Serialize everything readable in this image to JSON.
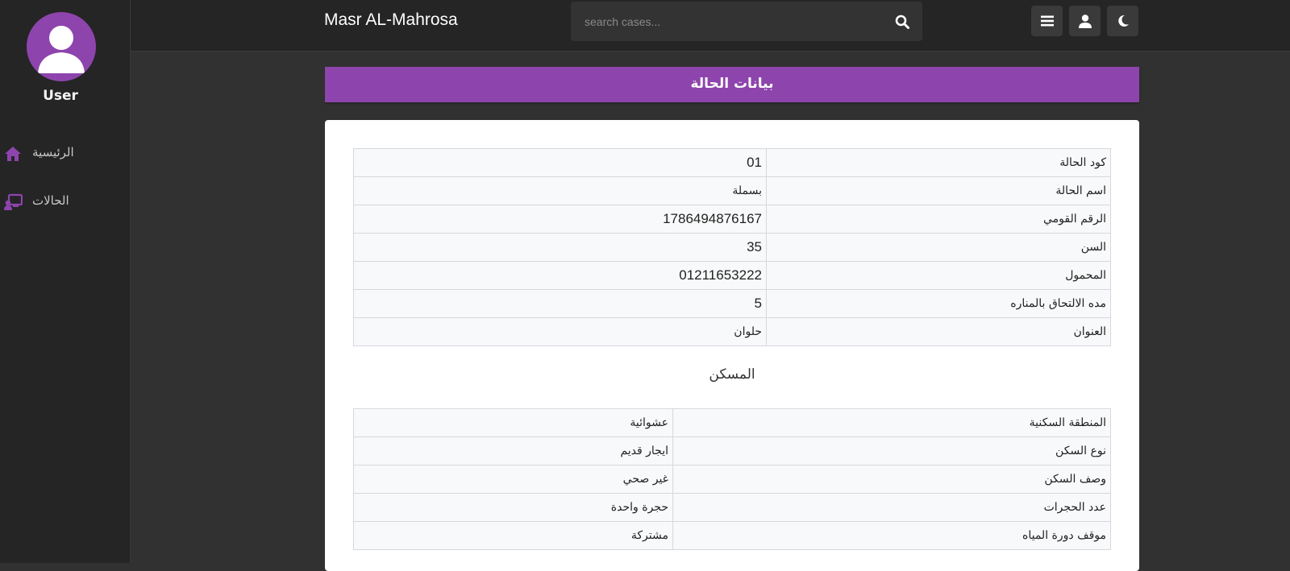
{
  "sidebar": {
    "user_name": "User",
    "items": [
      {
        "label": "الرئيسية",
        "icon": "home-icon"
      },
      {
        "label": "الحالات",
        "icon": "cases-icon"
      }
    ]
  },
  "topbar": {
    "brand": "Masr AL-Mahrosa",
    "search_placeholder": "search cases...",
    "buttons": [
      "menu-icon",
      "user-icon",
      "moon-icon"
    ]
  },
  "page": {
    "header": "بيانات الحالة",
    "case_info": [
      {
        "key": "كود الحالة",
        "value": "01"
      },
      {
        "key": "اسم الحالة",
        "value": "بسملة"
      },
      {
        "key": "الرقم القومي",
        "value": "1786494876167"
      },
      {
        "key": "السن",
        "value": "35"
      },
      {
        "key": "المحمول",
        "value": "01211653222"
      },
      {
        "key": "مده الالتحاق بالمناره",
        "value": "5"
      },
      {
        "key": "العنوان",
        "value": "حلوان"
      }
    ],
    "housing_title": "المسكن",
    "housing": [
      {
        "key": "المنطقة السكنية",
        "value": "عشوائية"
      },
      {
        "key": "نوع السكن",
        "value": "ايجار قديم"
      },
      {
        "key": "وصف السكن",
        "value": "غير صحي"
      },
      {
        "key": "عدد الحجرات",
        "value": "حجرة واحدة"
      },
      {
        "key": "موقف دورة المياه",
        "value": "مشتركة"
      }
    ]
  },
  "colors": {
    "accent": "#8e44ad",
    "sidebar_bg": "#252525",
    "page_bg": "#313131"
  }
}
